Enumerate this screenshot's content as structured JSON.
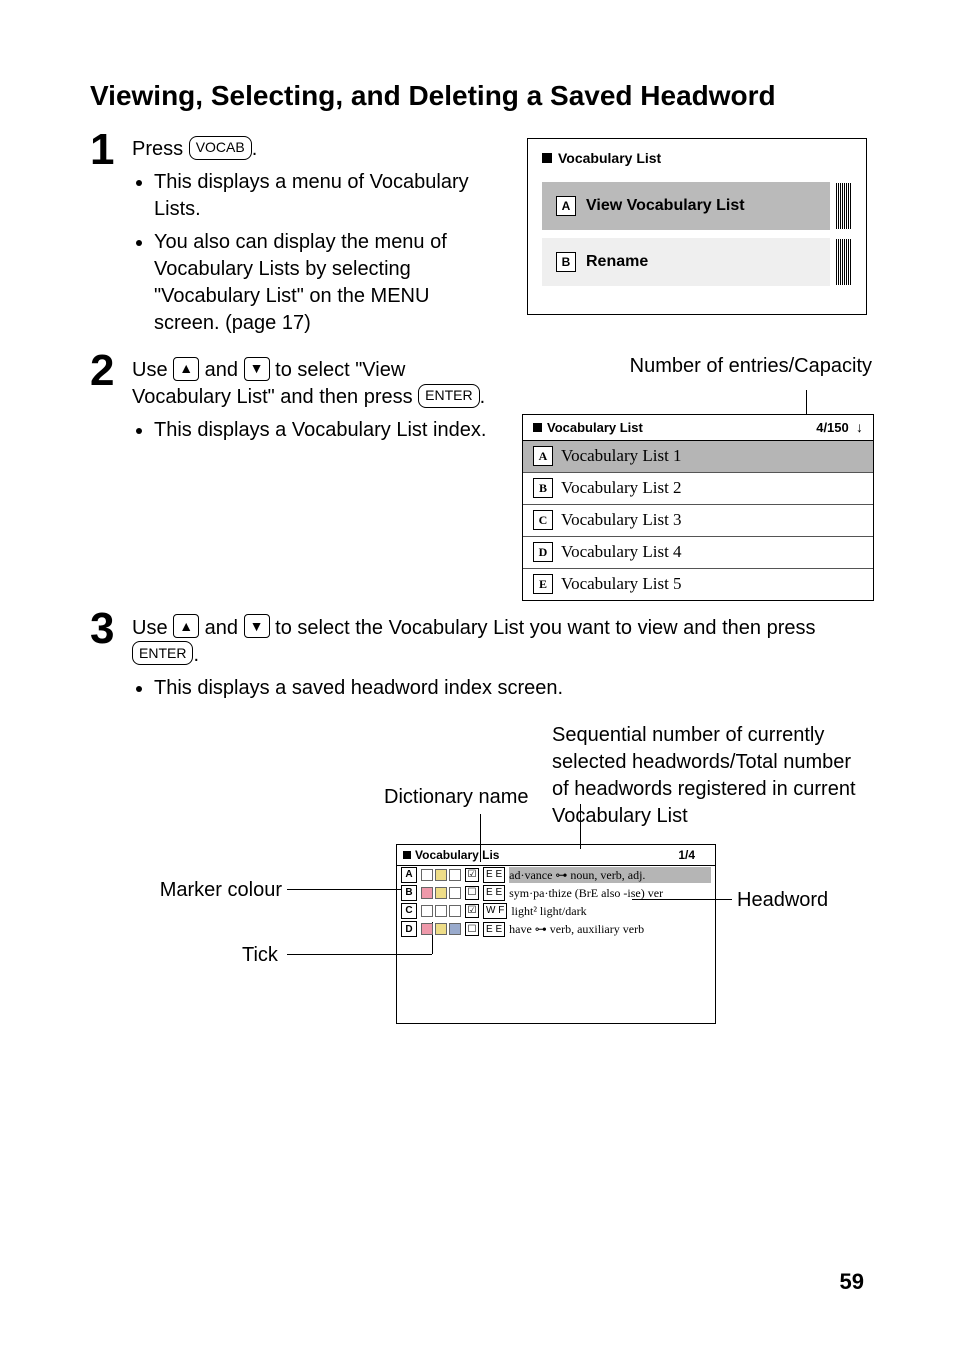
{
  "title": "Viewing, Selecting, and Deleting a Saved Headword",
  "page_number": "59",
  "steps": {
    "s1": {
      "num": "1",
      "lead_a": "Press ",
      "key": "VOCAB",
      "lead_b": ".",
      "b1": "This displays a menu of Vocabulary Lists.",
      "b2": "You also can display the menu of Vocabulary Lists by selecting \"Vocabulary List\" on the MENU screen. (page 17)"
    },
    "s2": {
      "num": "2",
      "lead_a": "Use ",
      "key_up": "▲",
      "lead_b": " and ",
      "key_down": "▼",
      "lead_c": " to select \"View Vocabulary List\" and then press ",
      "key_enter": "ENTER",
      "lead_d": ".",
      "b1": "This displays a Vocabulary List index."
    },
    "s3": {
      "num": "3",
      "lead_a": "Use ",
      "key_up": "▲",
      "lead_b": " and ",
      "key_down": "▼",
      "lead_c": " to select the Vocabulary List you want to view and then press ",
      "key_enter": "ENTER",
      "lead_d": ".",
      "b1": "This displays a saved headword index screen."
    }
  },
  "screen1": {
    "title": "Vocabulary List",
    "itemA_letter": "A",
    "itemA_label": "View Vocabulary List",
    "itemB_letter": "B",
    "itemB_label": "Rename"
  },
  "screen2": {
    "caption": "Number of entries/Capacity",
    "title": "Vocabulary List",
    "counter": "4/150",
    "rows": [
      {
        "letter": "A",
        "label": "Vocabulary List 1"
      },
      {
        "letter": "B",
        "label": "Vocabulary List 2"
      },
      {
        "letter": "C",
        "label": "Vocabulary List 3"
      },
      {
        "letter": "D",
        "label": "Vocabulary List 4"
      },
      {
        "letter": "E",
        "label": "Vocabulary List 5"
      }
    ]
  },
  "screen3": {
    "title_short": "Vocabulary Lis",
    "counter": "1/4",
    "rows": [
      {
        "tick": "☑",
        "tag": "E E",
        "hw": "ad·vance ⊶ noun, verb, adj."
      },
      {
        "tick": "☐",
        "tag": "E E",
        "hw": "sym·pa·thize (BrE also -ise) ver"
      },
      {
        "tick": "☑",
        "tag": "W F",
        "hw": "light² light/dark"
      },
      {
        "tick": "☐",
        "tag": "E E",
        "hw": "have ⊶ verb, auxiliary verb"
      }
    ]
  },
  "labels": {
    "seq": "Sequential number of currently selected headwords/Total number of headwords registered in current Vocabulary List",
    "dictname": "Dictionary name",
    "marker": "Marker colour",
    "tick": "Tick",
    "headword": "Headword"
  }
}
